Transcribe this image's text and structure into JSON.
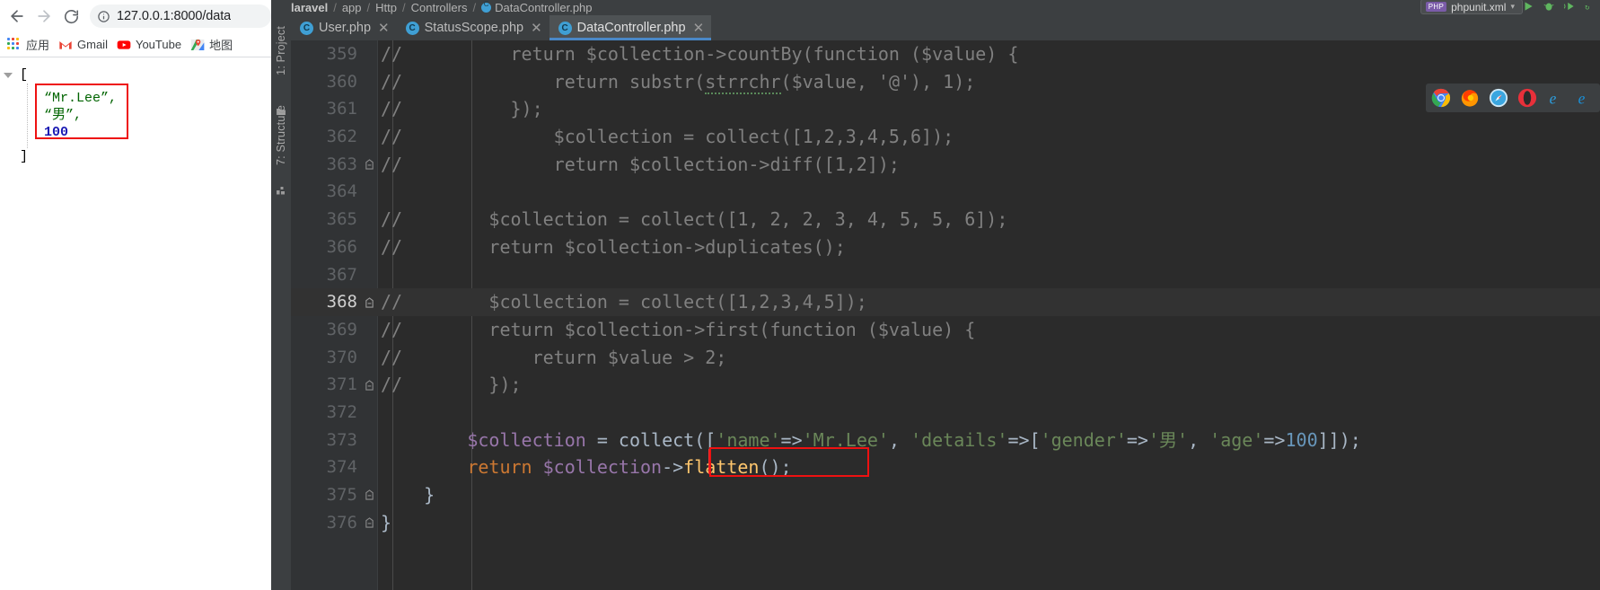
{
  "browser": {
    "nav": {
      "back": "back-arrow",
      "forward": "forward-arrow",
      "reload": "reload"
    },
    "omnibox": {
      "url": "127.0.0.1:8000/data",
      "info_icon": "info-circle"
    },
    "bookmarks": [
      {
        "label": "应用",
        "icon": "apps-grid-icon"
      },
      {
        "label": "Gmail",
        "icon": "gmail-icon"
      },
      {
        "label": "YouTube",
        "icon": "youtube-icon"
      },
      {
        "label": "地图",
        "icon": "maps-icon"
      }
    ],
    "json_output": {
      "open_bracket": "[",
      "close_bracket": "]",
      "items": [
        {
          "text": "“Mr.Lee”,",
          "type": "string"
        },
        {
          "text": "“男”,",
          "type": "string"
        },
        {
          "text": "100",
          "type": "number"
        }
      ]
    }
  },
  "ide": {
    "breadcrumb": [
      {
        "label": "laravel",
        "bold": true
      },
      {
        "label": "app"
      },
      {
        "label": "Http"
      },
      {
        "label": "Controllers"
      },
      {
        "label": "DataController.php",
        "icon": "php-class-icon"
      }
    ],
    "breadcrumb_separator": "/",
    "run_config": {
      "badge": "PHP",
      "name": "phpunit.xml",
      "chevron": "chevron-down-icon"
    },
    "run_icons": [
      "run-icon",
      "debug-icon",
      "coverage-icon",
      "profile-icon"
    ],
    "tool_windows": [
      {
        "label": "1: Project",
        "icon": "folder-icon"
      },
      {
        "label": "7: Structure",
        "icon": "structure-icon"
      }
    ],
    "tabs": [
      {
        "label": "User.php",
        "icon": "php-class-icon",
        "active": false,
        "closable": true
      },
      {
        "label": "StatusScope.php",
        "icon": "php-class-icon",
        "active": false,
        "closable": true
      },
      {
        "label": "DataController.php",
        "icon": "php-class-icon",
        "active": true,
        "closable": true
      }
    ],
    "browser_popup_icons": [
      "chrome-icon",
      "firefox-icon",
      "safari-icon",
      "opera-icon",
      "ie-icon",
      "edge-icon"
    ],
    "editor": {
      "current_line": 368,
      "lines": [
        {
          "num": 359,
          "fold": "",
          "text": "//          return $collection->countBy(function ($value) {",
          "current": false
        },
        {
          "num": 360,
          "fold": "",
          "text": "//              return substr(strrchr($value, '@'), 1);",
          "current": false
        },
        {
          "num": 361,
          "fold": "",
          "text": "//          });",
          "current": false
        },
        {
          "num": 362,
          "fold": "",
          "text": "//              $collection = collect([1,2,3,4,5,6]);",
          "current": false
        },
        {
          "num": 363,
          "fold": "collapse",
          "text": "//              return $collection->diff([1,2]);",
          "current": false
        },
        {
          "num": 364,
          "fold": "",
          "text": "",
          "current": false
        },
        {
          "num": 365,
          "fold": "",
          "text": "//        $collection = collect([1, 2, 2, 3, 4, 5, 5, 6]);",
          "current": false
        },
        {
          "num": 366,
          "fold": "",
          "text": "//        return $collection->duplicates();",
          "current": false
        },
        {
          "num": 367,
          "fold": "",
          "text": "",
          "current": false
        },
        {
          "num": 368,
          "fold": "collapse",
          "text": "//        $collection = collect([1,2,3,4,5]);",
          "current": true
        },
        {
          "num": 369,
          "fold": "",
          "text": "//        return $collection->first(function ($value) {",
          "current": false
        },
        {
          "num": 370,
          "fold": "",
          "text": "//            return $value > 2;",
          "current": false
        },
        {
          "num": 371,
          "fold": "collapse",
          "text": "//        });",
          "current": false
        },
        {
          "num": 372,
          "fold": "",
          "text": "",
          "current": false
        },
        {
          "num": 373,
          "fold": "",
          "text": "        $collection = collect(['name'=>'Mr.Lee', 'details'=>['gender'=>'男', 'age'=>100]]);",
          "current": false
        },
        {
          "num": 374,
          "fold": "",
          "text": "        return $collection->flatten();",
          "current": false
        },
        {
          "num": 375,
          "fold": "collapse",
          "text": "    }",
          "current": false
        },
        {
          "num": 376,
          "fold": "collapse",
          "text": "}",
          "current": false
        }
      ],
      "highlight_box_line": 374,
      "highlight_box_text": "flatten();"
    }
  },
  "colors": {
    "editor_bg": "#2b2b2b",
    "gutter_bg": "#313335",
    "chrome_bg": "#3c3f41",
    "accent_tab": "#4a88c7",
    "highlight_red": "#ee1111",
    "comment": "#808080",
    "string": "#6a8759",
    "number": "#6897bb",
    "keyword": "#cc7832",
    "variable": "#9876aa",
    "function": "#ffc66d"
  }
}
